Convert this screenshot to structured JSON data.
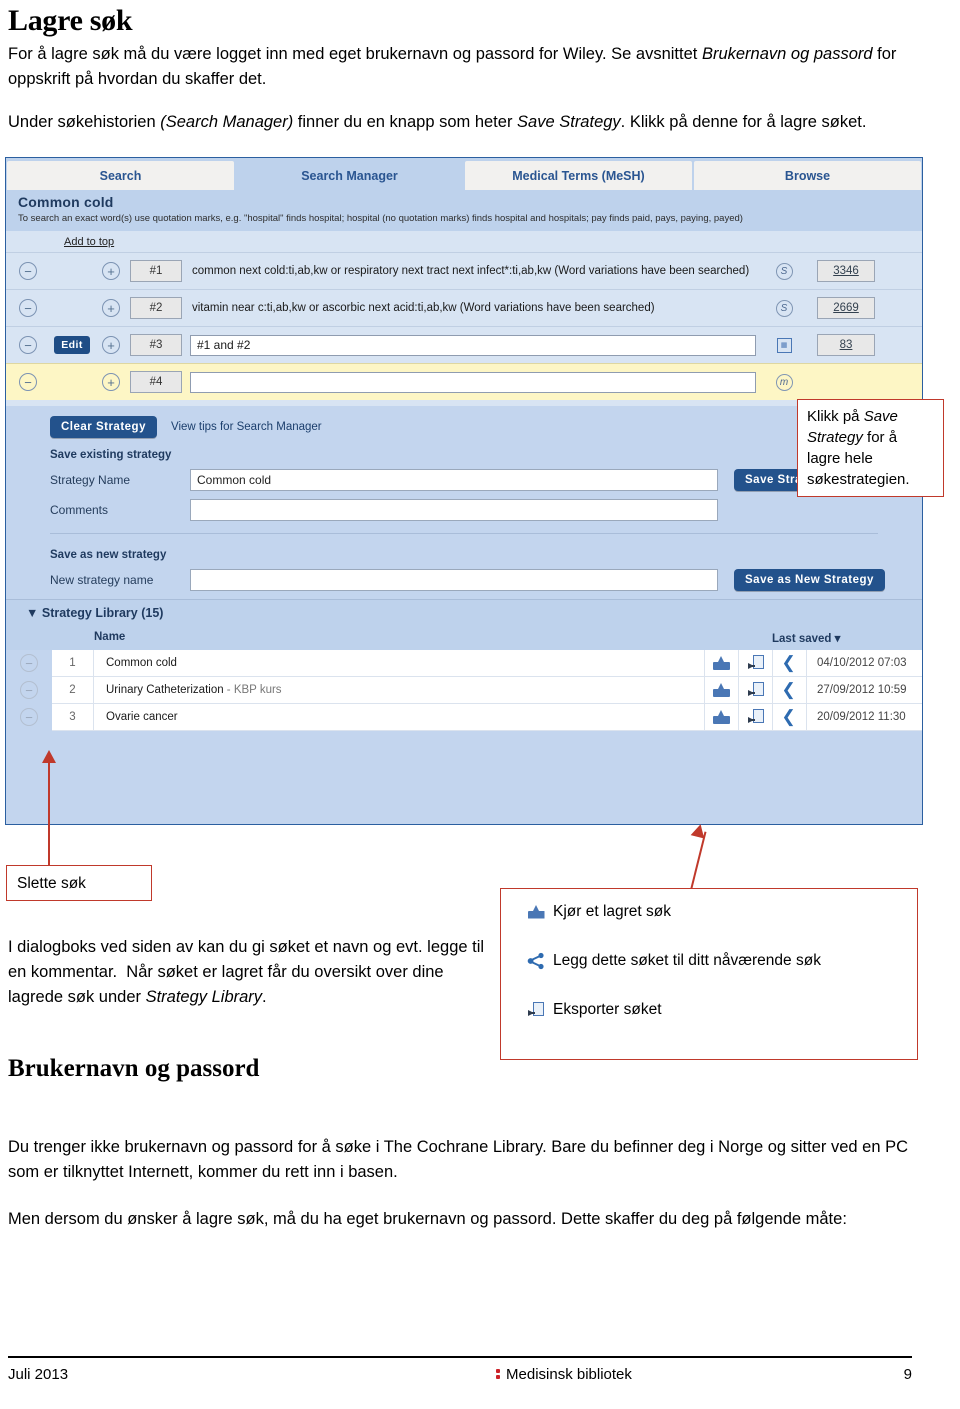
{
  "document": {
    "title": "Lagre søk",
    "intro_html": "For å lagre søk må du være logget inn med eget brukernavn og passord for Wiley. Se avsnittet <i>Brukernavn og passord</i> for oppskrift på hvordan du skaffer det.",
    "intro_plain": "For å lagre søk må du være logget inn med eget brukernavn og passord for Wiley. Se avsnittet Brukernavn og passord for oppskrift på hvordan du skaffer det.",
    "second_para_plain": "Under søkehistorien (Search Manager) finner du en knapp som heter Save Strategy. Klikk på denne for å lagre søket.",
    "subtitle": "Brukernavn og passord",
    "cochrane_para_1": "Du trenger ikke brukernavn og passord for å søke i The Cochrane Library. Bare du befinner deg i Norge og sitter ved en PC som er tilknyttet Internett, kommer du rett inn i basen.",
    "cochrane_para_2": "Men dersom du ønsker å lagre søk, må du ha eget brukernavn og passord. Dette skaffer du deg på følgende måte:"
  },
  "screenshot": {
    "tabs": [
      {
        "label": "Search",
        "active": false
      },
      {
        "label": "Search Manager",
        "active": true
      },
      {
        "label": "Medical Terms (MeSH)",
        "active": false
      },
      {
        "label": "Browse",
        "active": false
      }
    ],
    "search_band": {
      "title": "Common cold",
      "hint": "To search an exact word(s) use quotation marks, e.g. \"hospital\" finds hospital; hospital (no quotation marks) finds hospital and hospitals; pay finds paid, pays, paying, payed)"
    },
    "add_to_top": "Add to top",
    "rows": [
      {
        "id": "#1",
        "query": "common next cold:ti,ab,kw or respiratory next tract next infect*:ti,ab,kw (Word variations have been searched)",
        "is_input": false,
        "has_edit": false,
        "icon": "s-circle-icon",
        "icon_label": "S",
        "count": "3346",
        "highlight": false
      },
      {
        "id": "#2",
        "query": "vitamin near c:ti,ab,kw or ascorbic next acid:ti,ab,kw (Word variations have been searched)",
        "is_input": false,
        "has_edit": false,
        "icon": "s-circle-icon",
        "icon_label": "S",
        "count": "2669",
        "highlight": false
      },
      {
        "id": "#3",
        "query": "#1 and #2",
        "is_input": true,
        "has_edit": true,
        "edit_label": "Edit",
        "icon": "grid-icon",
        "icon_label": "",
        "count": "83",
        "highlight": false
      },
      {
        "id": "#4",
        "query": "",
        "is_input": true,
        "has_edit": false,
        "icon": "m-circle-icon",
        "icon_label": "m",
        "count": "",
        "highlight": true
      }
    ],
    "buttons": {
      "clear_strategy": "Clear Strategy",
      "view_tips": "View tips for Search Manager",
      "save_strategy": "Save Strategy",
      "save_as_new_strategy": "Save as New Strategy"
    },
    "save_existing": {
      "section_label": "Save existing strategy",
      "strategy_name_label": "Strategy Name",
      "strategy_name_value": "Common cold",
      "comments_label": "Comments",
      "comments_value": ""
    },
    "save_new": {
      "section_label": "Save as new strategy",
      "new_name_label": "New strategy name",
      "new_name_value": ""
    },
    "strategy_library": {
      "header": "Strategy Library (15)",
      "columns": {
        "name": "Name",
        "last_saved": "Last saved"
      },
      "rows": [
        {
          "num": "1",
          "name": "Common cold",
          "name_dim": "",
          "last_saved": "04/10/2012 07:03"
        },
        {
          "num": "2",
          "name": "Urinary Catheterization",
          "name_dim": " - KBP kurs",
          "last_saved": "27/09/2012 10:59"
        },
        {
          "num": "3",
          "name": "Ovarie cancer",
          "name_dim": "",
          "last_saved": "20/09/2012 11:30"
        }
      ]
    }
  },
  "annotations": {
    "save_callout_plain": "Klikk på Save Strategy for å lagre hele søkestrategien.",
    "slette_sok": "Slette søk",
    "dialog_text_plain": "I dialogboks ved siden av kan du gi søket et navn og evt. legge til en kommentar.  Når søket er lagret får du oversikt over dine lagrede søk under Strategy Library.",
    "icon_legend": [
      {
        "icon": "inbox-download-icon",
        "label": "Kjør et lagret søk"
      },
      {
        "icon": "share-icon",
        "label": "Legg dette søket til ditt nåværende søk"
      },
      {
        "icon": "export-document-icon",
        "label": "Eksporter søket"
      }
    ]
  },
  "footer": {
    "left": "Juli 2013",
    "center": "Medisinsk bibliotek",
    "right": "9"
  },
  "colors": {
    "accent_red": "#c0392b",
    "brand_blue": "#23528c",
    "panel_blue": "#c3d5ee",
    "band_blue": "#bed2ec",
    "highlight_yellow": "#fdf6c5",
    "logo_red": "#cc2229"
  }
}
